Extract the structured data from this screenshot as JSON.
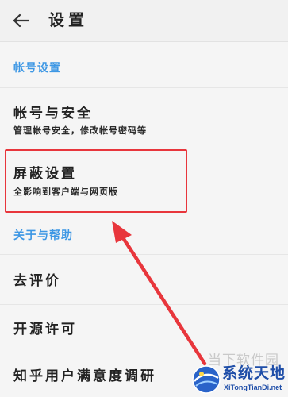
{
  "header": {
    "back_icon": "arrow-left-icon",
    "title": "设置"
  },
  "sections": {
    "account": {
      "title": "帐号设置",
      "items": [
        {
          "title": "帐号与安全",
          "subtitle": "管理帐号安全，修改帐号密码等"
        },
        {
          "title": "屏蔽设置",
          "subtitle": "全影响到客户端与网页版"
        }
      ]
    },
    "about": {
      "title": "关于与帮助",
      "items": [
        {
          "title": "去评价"
        },
        {
          "title": "开源许可"
        },
        {
          "title": "知乎用户满意度调研"
        }
      ]
    }
  },
  "annotation": {
    "highlight_color": "#e8363c",
    "arrow_color": "#e8363c"
  },
  "watermark": {
    "small_text": "当下软件园",
    "brand": "系统天地",
    "url": "XiTongTianDi.net"
  },
  "colors": {
    "accent": "#3d97e4",
    "background": "#f5f5f5"
  }
}
